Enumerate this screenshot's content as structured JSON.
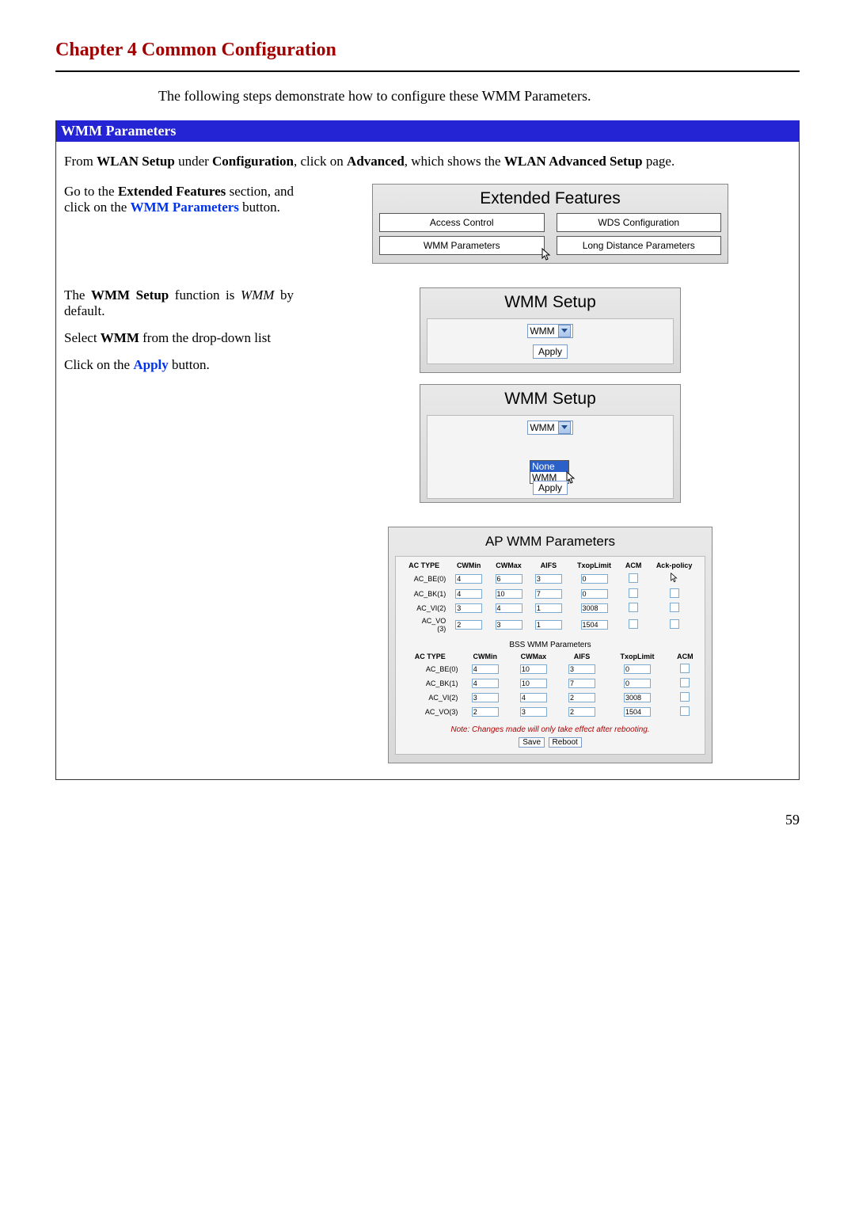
{
  "chapter_heading": "Chapter 4     Common Configuration",
  "intro": "The following steps demonstrate how to configure these WMM Parameters.",
  "blue_header": "WMM Parameters",
  "para1_parts": {
    "from": "From ",
    "wlan_setup": "WLAN Setup",
    "under": " under ",
    "configuration": "Configuration",
    "click_on": ", click on  ",
    "advanced": "Advanced",
    "shows": ", which shows the ",
    "wlan_advanced": "WLAN Advanced Setup",
    "page": " page."
  },
  "step_a": {
    "goto": "Go to the ",
    "ext_feat": "Extended Features",
    "section": " section, and click on the ",
    "wmm_btn": "WMM Parameters",
    "btn_word": " button."
  },
  "step_b": {
    "the": "The ",
    "wmm_setup": "WMM Setup",
    "func": " function is ",
    "wmm_italic": "WMM",
    "by_default": " by default.",
    "select": "Select ",
    "wmm_bold": "WMM",
    "from_dd": " from the drop-down list",
    "click_on": "Click on the ",
    "apply": "Apply",
    "btn_word": " button."
  },
  "extended_panel": {
    "title": "Extended Features",
    "btns": [
      "Access Control",
      "WDS Configuration",
      "WMM Parameters",
      "Long Distance Parameters"
    ]
  },
  "wmm_panel_1": {
    "title": "WMM Setup",
    "selected": "WMM",
    "apply": "Apply"
  },
  "wmm_panel_2": {
    "title": "WMM Setup",
    "selected": "WMM",
    "options": [
      "None",
      "WMM"
    ],
    "apply": "Apply"
  },
  "ap_panel": {
    "title": "AP WMM Parameters",
    "headers_ap": [
      "AC TYPE",
      "CWMin",
      "CWMax",
      "AIFS",
      "TxopLimit",
      "ACM",
      "Ack-policy"
    ],
    "rows_ap": [
      {
        "type": "AC_BE(0)",
        "cwmin": "4",
        "cwmax": "6",
        "aifs": "3",
        "txop": "0"
      },
      {
        "type": "AC_BK(1)",
        "cwmin": "4",
        "cwmax": "10",
        "aifs": "7",
        "txop": "0"
      },
      {
        "type": "AC_VI(2)",
        "cwmin": "3",
        "cwmax": "4",
        "aifs": "1",
        "txop": "3008"
      },
      {
        "type": "AC_VO(3)",
        "cwmin": "2",
        "cwmax": "3",
        "aifs": "1",
        "txop": "1504"
      }
    ],
    "bss_title": "BSS WMM Parameters",
    "headers_bss": [
      "AC TYPE",
      "CWMin",
      "CWMax",
      "AIFS",
      "TxopLimit",
      "ACM"
    ],
    "rows_bss": [
      {
        "type": "AC_BE(0)",
        "cwmin": "4",
        "cwmax": "10",
        "aifs": "3",
        "txop": "0"
      },
      {
        "type": "AC_BK(1)",
        "cwmin": "4",
        "cwmax": "10",
        "aifs": "7",
        "txop": "0"
      },
      {
        "type": "AC_VI(2)",
        "cwmin": "3",
        "cwmax": "4",
        "aifs": "2",
        "txop": "3008"
      },
      {
        "type": "AC_VO(3)",
        "cwmin": "2",
        "cwmax": "3",
        "aifs": "2",
        "txop": "1504"
      }
    ],
    "note": "Note: Changes made will only take effect after rebooting.",
    "save": "Save",
    "reboot": "Reboot"
  },
  "page_number": "59"
}
